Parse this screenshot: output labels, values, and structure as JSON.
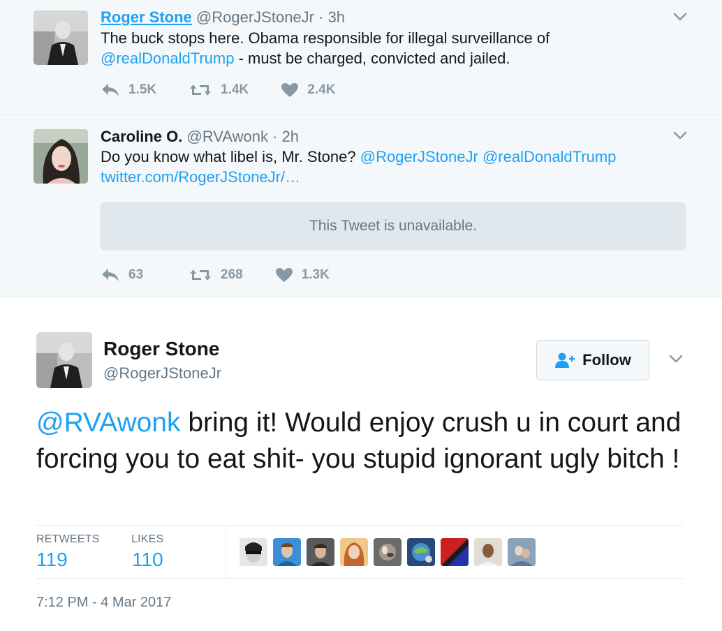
{
  "context_tweets": [
    {
      "name": "Roger Stone",
      "handle": "@RogerJStoneJr",
      "time": "· 3h",
      "text_line1": "The buck stops here. Obama responsible for illegal surveillance of",
      "mention": "@realDonaldTrump",
      "text_line2_rest": " - must be charged, convicted and jailed.",
      "replies": "1.5K",
      "retweets": "1.4K",
      "likes": "2.4K"
    },
    {
      "name": "Caroline O.",
      "handle": "@RVAwonk",
      "time": "· 2h",
      "text_prefix": "Do you know what libel is, Mr. Stone? ",
      "mention1": "@RogerJStoneJr",
      "mention2": "@realDonaldTrump",
      "link": "twitter.com/RogerJStoneJr/…",
      "unavailable": "This Tweet is unavailable.",
      "replies": "63",
      "retweets": "268",
      "likes": "1.3K"
    }
  ],
  "main_tweet": {
    "name": "Roger Stone",
    "handle": "@RogerJStoneJr",
    "follow_label": "Follow",
    "mention": "@RVAwonk",
    "text": " bring it! Would enjoy crush u in court and forcing you to eat shit- you stupid ignorant ugly bitch !",
    "retweets_label": "RETWEETS",
    "retweets": "119",
    "likes_label": "LIKES",
    "likes": "110",
    "timestamp": "7:12 PM - 4 Mar 2017"
  },
  "colors": {
    "accent": "#1da1f2",
    "context_bg": "#f5f8fa",
    "muted": "#8899a6"
  }
}
